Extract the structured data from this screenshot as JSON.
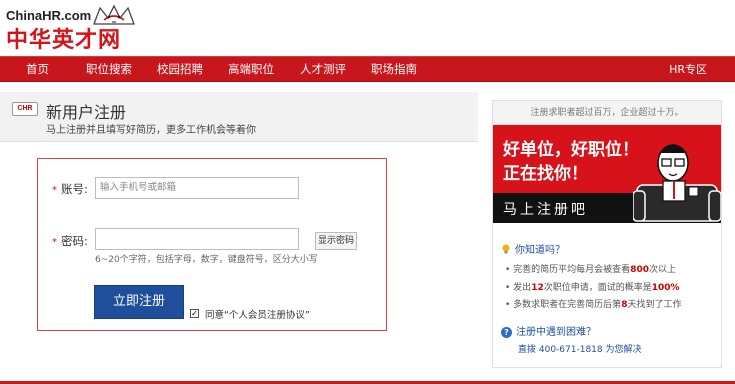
{
  "logo": {
    "en": "ChinaHR.com",
    "cn": "中华英才网",
    "mascot": "fox-mascot-logo"
  },
  "nav": {
    "items": [
      {
        "label": "首页"
      },
      {
        "label": "职位搜索"
      },
      {
        "label": "校园招聘"
      },
      {
        "label": "高端职位"
      },
      {
        "label": "人才测评"
      },
      {
        "label": "职场指南"
      }
    ],
    "right_label": "HR专区"
  },
  "page": {
    "icon_text": "CHR",
    "title": "新用户注册",
    "subtitle": "马上注册并且填写好简历，更多工作机会等着你"
  },
  "form": {
    "account_label": "账号:",
    "account_placeholder": "输入手机号或邮箱",
    "password_label": "密码:",
    "password_value": "",
    "show_password_label": "显示密码",
    "password_hint": "6~20个字符，包括字母，数字，键盘符号，区分大小写",
    "submit_label": "立即注册",
    "agree_checked": "✓",
    "agree_prefix": "同意",
    "agree_link": "“个人会员注册协议”"
  },
  "sidebar": {
    "top_text": "注册求职者超过百万，企业超过十万。",
    "banner": {
      "line1": "好单位，好职位！",
      "line2": "正在找你！",
      "cta": "马上注册吧",
      "figure": "cartoon-man-on-couch"
    },
    "know_title": "你知道吗？",
    "tips": [
      {
        "pre": "完善的简历平均每月会被查看",
        "em": "800",
        "post": "次以上"
      },
      {
        "pre": "发出",
        "em": "12",
        "post": "次职位申请，面试的概率是",
        "em2": "100%"
      },
      {
        "pre": "多数求职者在完善简历后第",
        "em": "8",
        "post": "天找到了工作"
      }
    ],
    "help_title": "注册中遇到困难？",
    "help_line": "直拨 400-671-1818 为您解决"
  },
  "colors": {
    "brand_red": "#c8161d",
    "button_blue": "#1f4f9c",
    "form_border": "#e53f40"
  }
}
